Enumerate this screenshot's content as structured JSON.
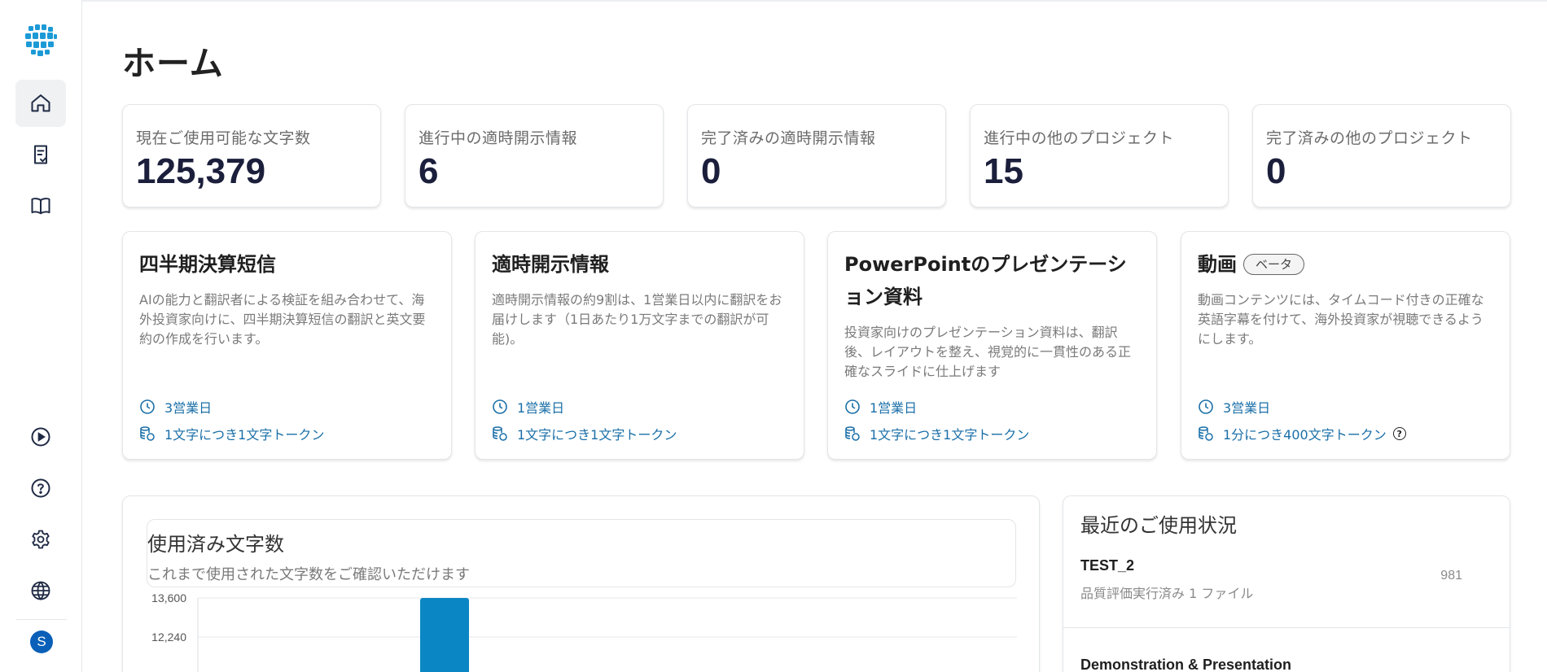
{
  "page": {
    "title": "ホーム"
  },
  "sidebar": {
    "nav": [
      {
        "name": "home",
        "icon": "home-icon"
      },
      {
        "name": "tasks",
        "icon": "document-check-icon"
      },
      {
        "name": "glossary",
        "icon": "book-icon"
      }
    ],
    "bottom": [
      {
        "name": "tutorial",
        "icon": "play-circle-icon"
      },
      {
        "name": "help",
        "icon": "question-circle-icon"
      },
      {
        "name": "settings",
        "icon": "gear-icon"
      },
      {
        "name": "language",
        "icon": "globe-icon"
      }
    ],
    "avatar_initial": "S"
  },
  "stats": [
    {
      "label": "現在ご使用可能な文字数",
      "value": "125,379"
    },
    {
      "label": "進行中の適時開示情報",
      "value": "6"
    },
    {
      "label": "完了済みの適時開示情報",
      "value": "0"
    },
    {
      "label": "進行中の他のプロジェクト",
      "value": "15"
    },
    {
      "label": "完了済みの他のプロジェクト",
      "value": "0"
    }
  ],
  "services": [
    {
      "title": "四半期決算短信",
      "description": "AIの能力と翻訳者による検証を組み合わせて、海外投資家向けに、四半期決算短信の翻訳と英文要約の作成を行います。",
      "turnaround": "3営業日",
      "cost": "1文字につき1文字トークン"
    },
    {
      "title": "適時開示情報",
      "description": "適時開示情報の約9割は、1営業日以内に翻訳をお届けします（1日あたり1万文字までの翻訳が可能)。",
      "turnaround": "1営業日",
      "cost": "1文字につき1文字トークン"
    },
    {
      "title": "PowerPointのプレゼンテーション資料",
      "description": "投資家向けのプレゼンテーション資料は、翻訳後、レイアウトを整え、視覚的に一貫性のある正確なスライドに仕上げます",
      "turnaround": "1営業日",
      "cost": "1文字につき1文字トークン"
    },
    {
      "title": "動画",
      "badge": "ベータ",
      "description": "動画コンテンツには、タイムコード付きの正確な英語字幕を付けて、海外投資家が視聴できるようにします。",
      "turnaround": "3営業日",
      "cost": "1分につき400文字トークン",
      "help_mark": "?"
    }
  ],
  "usage": {
    "title": "使用済み文字数",
    "subtitle": "これまで使用された文字数をご確認いただけます"
  },
  "chart_data": {
    "type": "bar",
    "title": "使用済み文字数",
    "yticks": [
      13600,
      12240
    ],
    "ytick_labels": [
      "13,600",
      "12,240"
    ],
    "values": [
      0,
      0,
      13600
    ],
    "bar_color": "#0a86c4",
    "grid": true
  },
  "recent": {
    "title": "最近のご使用状況",
    "items": [
      {
        "name": "TEST_2",
        "detail": "品質評価実行済み 1 ファイル",
        "count": "981"
      },
      {
        "name": "Demonstration & Presentation",
        "detail": "",
        "count": ""
      }
    ]
  },
  "colors": {
    "accent": "#1a6fa8",
    "avatar": "#0a5fb8",
    "bar": "#0a86c4"
  }
}
